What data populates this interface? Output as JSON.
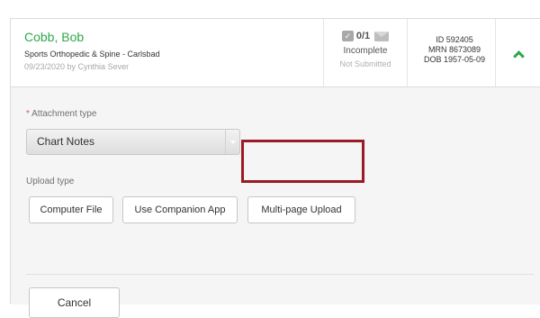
{
  "patient": {
    "name": "Cobb, Bob",
    "practice": "Sports Orthopedic & Spine - Carlsbad",
    "date_by": "09/23/2020 by Cynthia Sever"
  },
  "status": {
    "count": "0/1",
    "state": "Incomplete",
    "submission": "Not Submitted"
  },
  "identifiers": {
    "id": "ID 592405",
    "mrn": "MRN 8673089",
    "dob": "DOB 1957-05-09"
  },
  "form": {
    "attachment_label_required": "*",
    "attachment_label": "Attachment type",
    "attachment_value": "Chart Notes",
    "upload_label": "Upload type",
    "upload_buttons": [
      "Computer File",
      "Use Companion App",
      "Multi-page Upload"
    ],
    "cancel_label": "Cancel"
  },
  "colors": {
    "accent": "#2ea84a",
    "highlight": "#9b1b24",
    "required": "#e0534a"
  },
  "icons": {
    "check": "check-box-icon",
    "message": "envelope-icon",
    "collapse": "chevron-up-icon"
  }
}
